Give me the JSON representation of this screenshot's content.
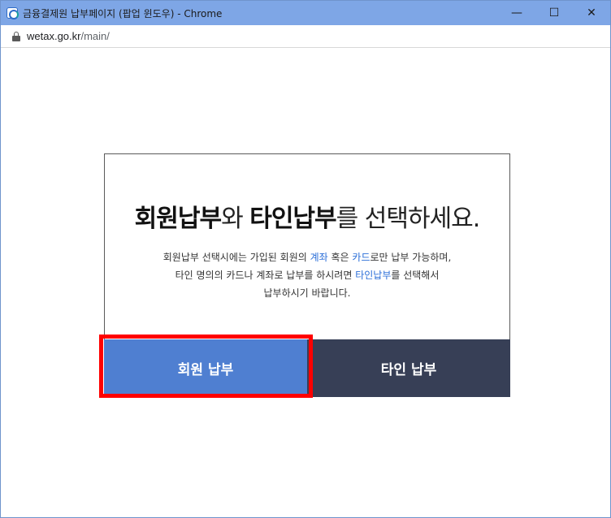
{
  "window": {
    "title": "금융결제원 납부페이지 (팝업 윈도우) - Chrome",
    "controls": {
      "minimize": "—",
      "maximize": "☐",
      "close": "✕"
    }
  },
  "address": {
    "host": "wetax.go.kr",
    "path": "/main/"
  },
  "dialog": {
    "headline": {
      "part1": "회원납부",
      "part2": "와 ",
      "part3": "타인납부",
      "part4": "를 선택하세요."
    },
    "desc": {
      "l1a": "회원납부 선택시에는 가입된 회원의 ",
      "l1_link1": "계좌",
      "l1b": " 혹은 ",
      "l1_link2": "카드",
      "l1c": "로만 납부 가능하며,",
      "l2a": "타인 명의의 카드나 계좌로 납부를 하시려면 ",
      "l2_link": "타인납부",
      "l2b": "를 선택해서",
      "l3": "납부하시기 바랍니다."
    },
    "buttons": {
      "member": "회원 납부",
      "other": "타인 납부"
    }
  },
  "colors": {
    "titlebar": "#7ea6e6",
    "member_button": "#4f7fd1",
    "other_button": "#373f56",
    "link": "#2c6fd8",
    "highlight": "#ff0000"
  },
  "icons": {
    "app": "chrome-app-icon",
    "lock": "lock-icon"
  }
}
